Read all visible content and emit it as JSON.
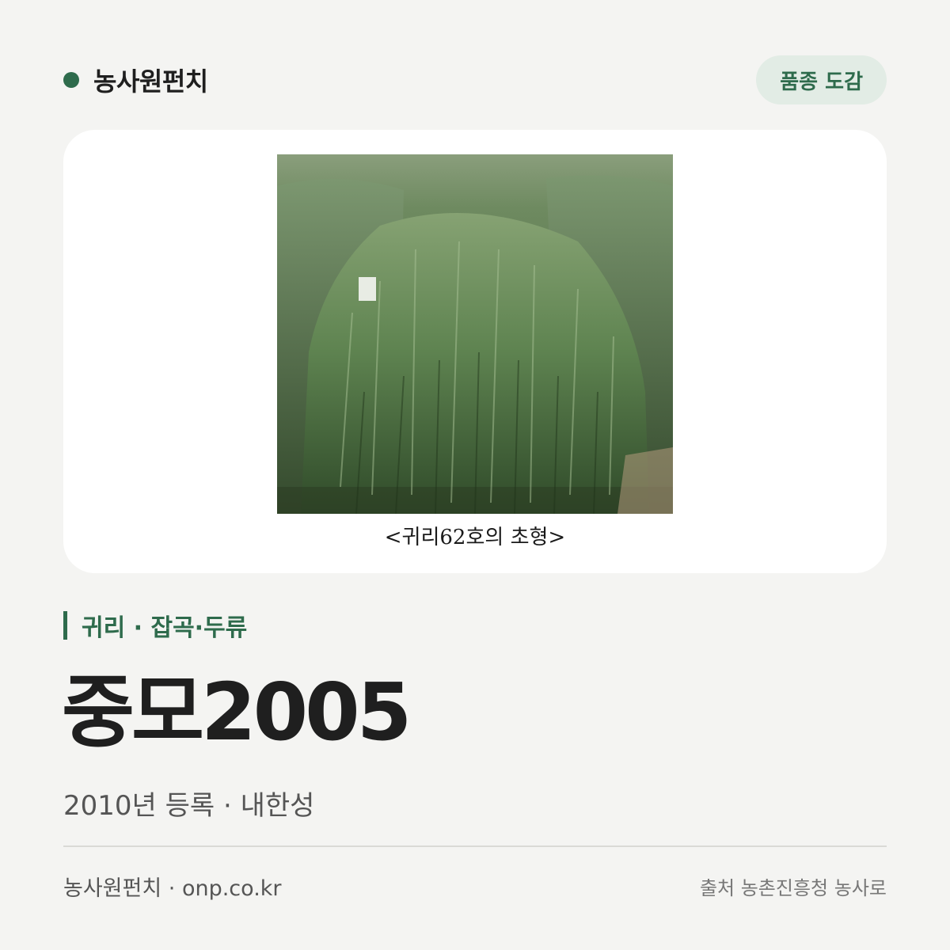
{
  "header": {
    "brand_name": "농사원펀치",
    "badge_label": "품종 도감"
  },
  "photo": {
    "caption": "<귀리62호의 초형>",
    "image_icon": "oat-field-photo"
  },
  "category": {
    "text": "귀리 · 잡곡·두류"
  },
  "variety": {
    "name": "중모2005",
    "meta": "2010년 등록 · 내한성"
  },
  "footer": {
    "left": "농사원펀치 · onp.co.kr",
    "right": "출처 농촌진흥청 농사로"
  },
  "colors": {
    "accent": "#2e6b4c",
    "badge_bg": "#e2ece5",
    "background": "#f4f4f2"
  }
}
